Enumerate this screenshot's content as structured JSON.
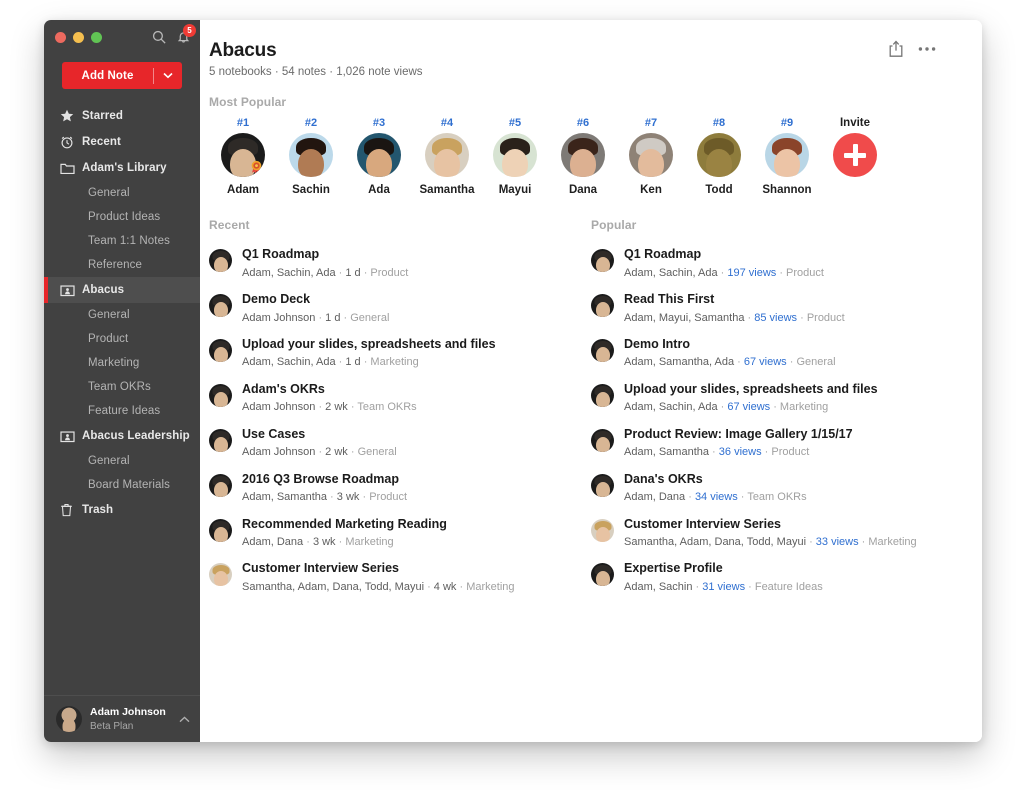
{
  "window": {
    "traffic_lights": [
      "close",
      "minimize",
      "zoom"
    ],
    "search_icon": "search-icon",
    "notifications_icon": "bell-icon",
    "notifications_count": "5"
  },
  "sidebar": {
    "add_note": {
      "label": "Add Note",
      "caret_icon": "chevron-down-icon"
    },
    "items": [
      {
        "label": "Starred",
        "icon": "star-icon",
        "level": "top",
        "active": false
      },
      {
        "label": "Recent",
        "icon": "clock-icon",
        "level": "top",
        "active": false
      },
      {
        "label": "Adam's Library",
        "icon": "folder-icon",
        "level": "top",
        "active": false
      },
      {
        "label": "General",
        "icon": "",
        "level": "child",
        "active": false
      },
      {
        "label": "Product Ideas",
        "icon": "",
        "level": "child",
        "active": false
      },
      {
        "label": "Team 1:1 Notes",
        "icon": "",
        "level": "child",
        "active": false
      },
      {
        "label": "Reference",
        "icon": "",
        "level": "child",
        "active": false
      },
      {
        "label": "Abacus",
        "icon": "shared-folder-icon",
        "level": "top",
        "active": true
      },
      {
        "label": "General",
        "icon": "",
        "level": "child",
        "active": false
      },
      {
        "label": "Product",
        "icon": "",
        "level": "child",
        "active": false
      },
      {
        "label": "Marketing",
        "icon": "",
        "level": "child",
        "active": false
      },
      {
        "label": "Team OKRs",
        "icon": "",
        "level": "child",
        "active": false
      },
      {
        "label": "Feature Ideas",
        "icon": "",
        "level": "child",
        "active": false
      },
      {
        "label": "Abacus Leadership",
        "icon": "shared-folder-icon",
        "level": "top",
        "active": false
      },
      {
        "label": "General",
        "icon": "",
        "level": "child",
        "active": false
      },
      {
        "label": "Board Materials",
        "icon": "",
        "level": "child",
        "active": false
      },
      {
        "label": "Trash",
        "icon": "trash-icon",
        "level": "top",
        "active": false
      }
    ],
    "user": {
      "name": "Adam Johnson",
      "plan": "Beta Plan",
      "chevron_icon": "chevron-up-icon"
    }
  },
  "header": {
    "title": "Abacus",
    "meta": "5 notebooks · 54 notes · 1,026 note views",
    "share_icon": "share-icon",
    "more_icon": "ellipsis-icon"
  },
  "most_popular": {
    "label": "Most Popular",
    "people": [
      {
        "rank": "#1",
        "name": "Adam",
        "award": true,
        "skin": "#d8b694",
        "hair": "#2e2a27",
        "bg": "#1b1b1b"
      },
      {
        "rank": "#2",
        "name": "Sachin",
        "award": false,
        "skin": "#b07b54",
        "hair": "#22150f",
        "bg": "#bcd9ea"
      },
      {
        "rank": "#3",
        "name": "Ada",
        "award": false,
        "skin": "#d8a87e",
        "hair": "#1a1512",
        "bg": "#23566e"
      },
      {
        "rank": "#4",
        "name": "Samantha",
        "award": false,
        "skin": "#e7c3a3",
        "hair": "#c9a25f",
        "bg": "#d8cfc0"
      },
      {
        "rank": "#5",
        "name": "Mayui",
        "award": false,
        "skin": "#eed2b6",
        "hair": "#2a211a",
        "bg": "#d7e3d2"
      },
      {
        "rank": "#6",
        "name": "Dana",
        "award": false,
        "skin": "#dcb091",
        "hair": "#3a241a",
        "bg": "#7e7a76"
      },
      {
        "rank": "#7",
        "name": "Ken",
        "award": false,
        "skin": "#e3bb9c",
        "hair": "#cfcac4",
        "bg": "#8e8276"
      },
      {
        "rank": "#8",
        "name": "Todd",
        "award": false,
        "skin": "#9a8342",
        "hair": "#6d5b28",
        "bg": "#8e7c3c"
      },
      {
        "rank": "#9",
        "name": "Shannon",
        "award": false,
        "skin": "#ecc4a6",
        "hair": "#8a442a",
        "bg": "#b9d6e6"
      }
    ],
    "invite": {
      "label": "Invite",
      "icon": "plus-icon"
    }
  },
  "recent": {
    "label": "Recent",
    "items": [
      {
        "title": "Q1 Roadmap",
        "authors": "Adam, Sachin, Ada",
        "time": "1 d",
        "notebook": "Product",
        "skin": "#d8b694",
        "hair": "#2e2a27",
        "bg": "#1b1b1b"
      },
      {
        "title": "Demo Deck",
        "authors": "Adam Johnson",
        "time": "1 d",
        "notebook": "General",
        "skin": "#d8b694",
        "hair": "#2e2a27",
        "bg": "#1b1b1b"
      },
      {
        "title": "Upload your slides, spreadsheets and files",
        "authors": "Adam, Sachin, Ada",
        "time": "1 d",
        "notebook": "Marketing",
        "skin": "#d8b694",
        "hair": "#2e2a27",
        "bg": "#1b1b1b"
      },
      {
        "title": "Adam's OKRs",
        "authors": "Adam Johnson",
        "time": "2 wk",
        "notebook": "Team OKRs",
        "skin": "#d8b694",
        "hair": "#2e2a27",
        "bg": "#1b1b1b"
      },
      {
        "title": "Use Cases",
        "authors": "Adam Johnson",
        "time": "2 wk",
        "notebook": "General",
        "skin": "#d8b694",
        "hair": "#2e2a27",
        "bg": "#1b1b1b"
      },
      {
        "title": "2016 Q3 Browse Roadmap",
        "authors": "Adam, Samantha",
        "time": "3 wk",
        "notebook": "Product",
        "skin": "#d8b694",
        "hair": "#2e2a27",
        "bg": "#1b1b1b"
      },
      {
        "title": "Recommended Marketing Reading",
        "authors": "Adam, Dana",
        "time": "3 wk",
        "notebook": "Marketing",
        "skin": "#d8b694",
        "hair": "#2e2a27",
        "bg": "#1b1b1b"
      },
      {
        "title": "Customer Interview Series",
        "authors": "Samantha, Adam, Dana, Todd, Mayui",
        "time": "4 wk",
        "notebook": "Marketing",
        "skin": "#e7c3a3",
        "hair": "#c9a25f",
        "bg": "#d8cfc0"
      }
    ]
  },
  "popular": {
    "label": "Popular",
    "items": [
      {
        "title": "Q1 Roadmap",
        "authors": "Adam, Sachin, Ada",
        "views": "197 views",
        "notebook": "Product",
        "skin": "#d8b694",
        "hair": "#2e2a27",
        "bg": "#1b1b1b"
      },
      {
        "title": "Read This First",
        "authors": "Adam, Mayui, Samantha",
        "views": "85 views",
        "notebook": "Product",
        "skin": "#d8b694",
        "hair": "#2e2a27",
        "bg": "#1b1b1b"
      },
      {
        "title": "Demo Intro",
        "authors": "Adam, Samantha, Ada",
        "views": "67 views",
        "notebook": "General",
        "skin": "#d8b694",
        "hair": "#2e2a27",
        "bg": "#1b1b1b"
      },
      {
        "title": "Upload your slides, spreadsheets and files",
        "authors": "Adam, Sachin, Ada",
        "views": "67 views",
        "notebook": "Marketing",
        "skin": "#d8b694",
        "hair": "#2e2a27",
        "bg": "#1b1b1b"
      },
      {
        "title": "Product Review: Image Gallery 1/15/17",
        "authors": "Adam, Samantha",
        "views": "36 views",
        "notebook": "Product",
        "skin": "#d8b694",
        "hair": "#2e2a27",
        "bg": "#1b1b1b"
      },
      {
        "title": "Dana's OKRs",
        "authors": "Adam, Dana",
        "views": "34 views",
        "notebook": "Team OKRs",
        "skin": "#d8b694",
        "hair": "#2e2a27",
        "bg": "#1b1b1b"
      },
      {
        "title": "Customer Interview Series",
        "authors": "Samantha, Adam, Dana, Todd, Mayui",
        "views": "33 views",
        "notebook": "Marketing",
        "skin": "#e7c3a3",
        "hair": "#c9a25f",
        "bg": "#d8cfc0"
      },
      {
        "title": "Expertise Profile",
        "authors": "Adam, Sachin",
        "views": "31 views",
        "notebook": "Feature Ideas",
        "skin": "#d8b694",
        "hair": "#2e2a27",
        "bg": "#1b1b1b"
      }
    ]
  },
  "colors": {
    "accent_red": "#e7262a",
    "invite_red": "#f04b4b",
    "link_blue": "#2f6fd0",
    "sidebar_bg": "#414141",
    "sidebar_active_bg": "#4e4e4e"
  }
}
